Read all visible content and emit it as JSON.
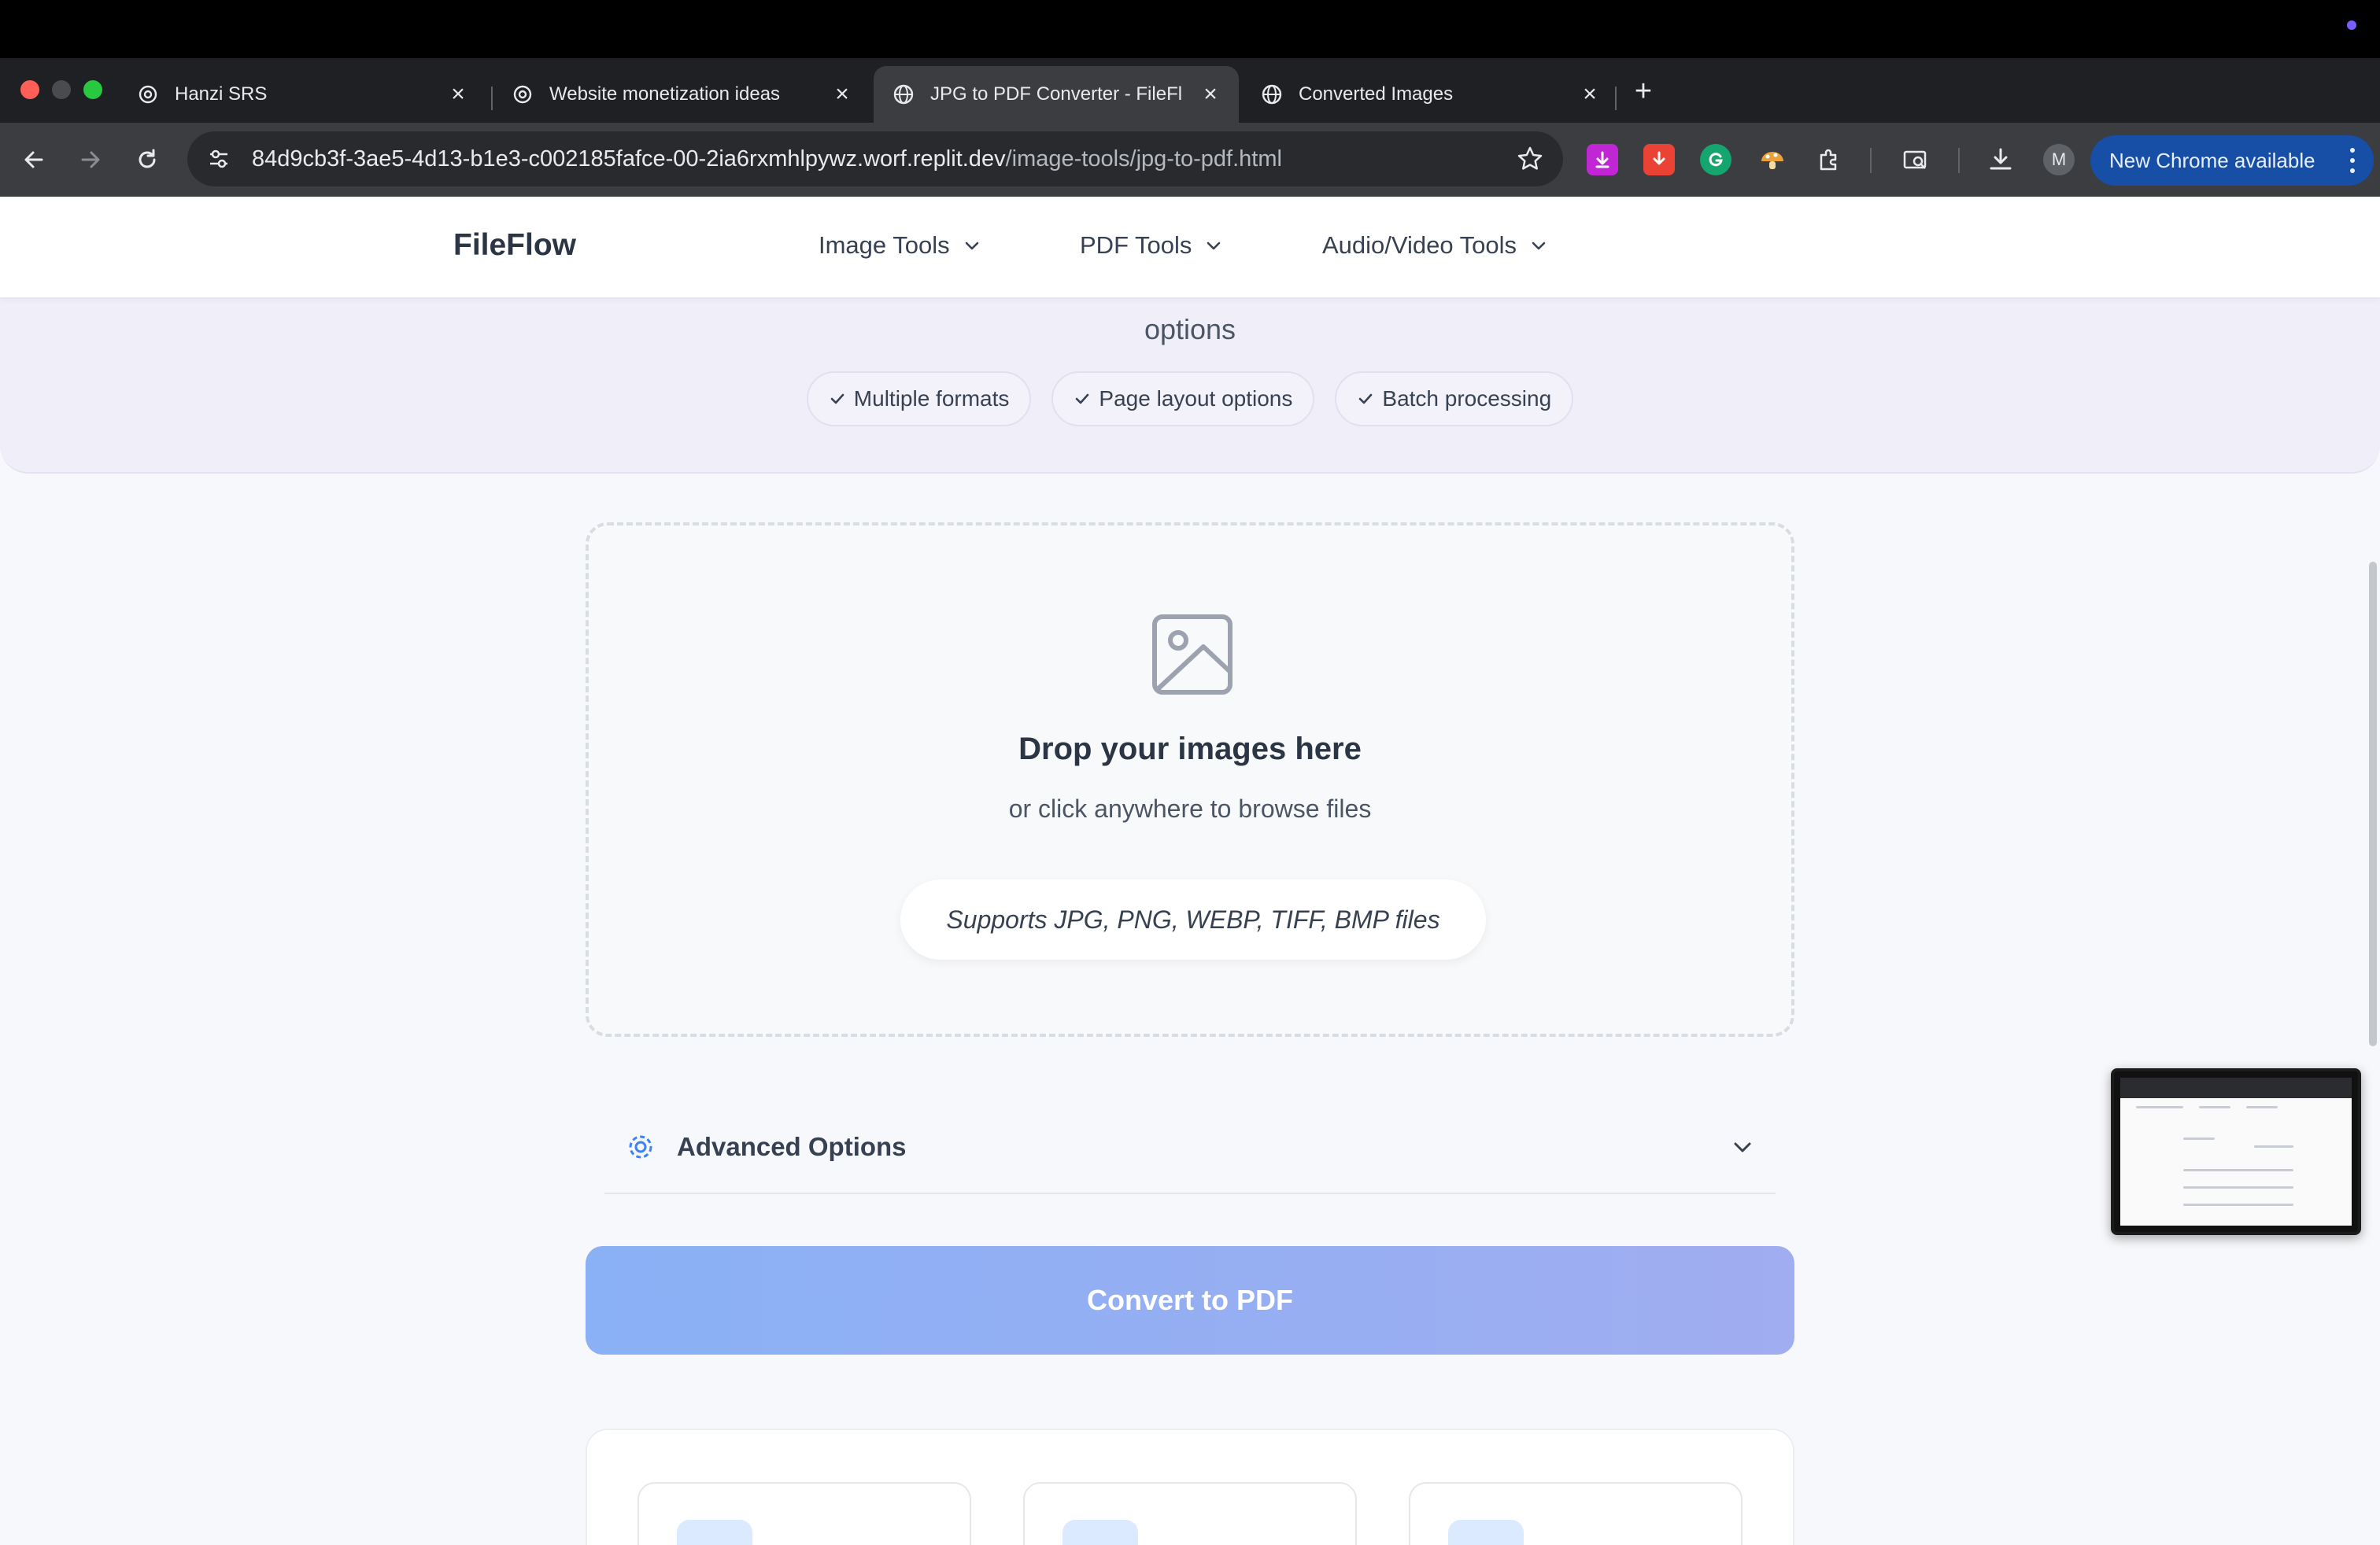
{
  "browser": {
    "tabs": [
      {
        "title": "Hanzi SRS",
        "icon": "openai-icon",
        "active": false
      },
      {
        "title": "Website monetization ideas",
        "icon": "openai-icon",
        "active": false
      },
      {
        "title": "JPG to PDF Converter - FileFl",
        "icon": "globe-icon",
        "active": true
      },
      {
        "title": "Converted Images",
        "icon": "globe-icon",
        "active": false
      }
    ],
    "url_host": "84d9cb3f-3ae5-4d13-b1e3-c002185fafce-00-2ia6rxmhlpywz.worf.replit.dev",
    "url_path": "/image-tools/jpg-to-pdf.html",
    "profile_initial": "M",
    "update_label": "New Chrome available"
  },
  "site": {
    "logo": "FileFlow",
    "nav": [
      "Image Tools",
      "PDF Tools",
      "Audio/Video Tools"
    ]
  },
  "hero": {
    "subtitle_tail": "options",
    "badges": [
      "Multiple formats",
      "Page layout options",
      "Batch processing"
    ]
  },
  "dropzone": {
    "title": "Drop your images here",
    "subtitle": "or click anywhere to browse files",
    "supports": "Supports JPG, PNG, WEBP, TIFF, BMP files"
  },
  "advanced": {
    "label": "Advanced Options"
  },
  "convert": {
    "label": "Convert to PDF"
  },
  "colors": {
    "accent": "#3b82f6",
    "chrome_dark": "#3c3d41",
    "update_blue": "#174ea6"
  }
}
